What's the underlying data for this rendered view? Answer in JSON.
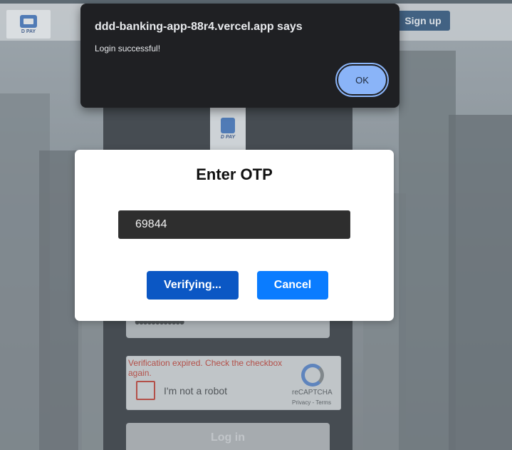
{
  "header": {
    "logo_text": "D PAY",
    "signup_label": "Sign up"
  },
  "login_card": {
    "logo_text": "D PAY",
    "password_masked": "••••••••••••",
    "recaptcha": {
      "error": "Verification expired. Check the checkbox again.",
      "label": "I'm not a robot",
      "brand": "reCAPTCHA",
      "terms": "Privacy - Terms"
    },
    "login_label": "Log in"
  },
  "otp_modal": {
    "title": "Enter OTP",
    "otp_value": "69844",
    "verify_label": "Verifying...",
    "cancel_label": "Cancel"
  },
  "alert": {
    "title": "ddd-banking-app-88r4.vercel.app says",
    "message": "Login successful!",
    "ok_label": "OK"
  },
  "colors": {
    "alert_bg": "#1f2023",
    "ok_button": "#8ab4f8",
    "verify_button": "#0b57c4",
    "cancel_button": "#0a7cff",
    "recaptcha_error": "#b3271c"
  }
}
